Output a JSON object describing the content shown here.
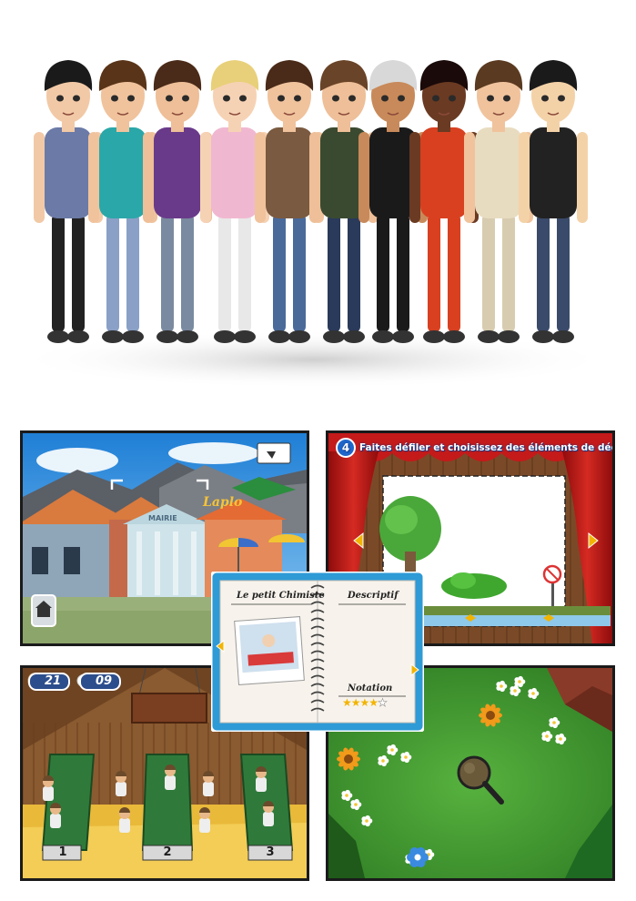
{
  "village": {
    "sign_text": "Laplo",
    "town_hall_label": "MAIRIE"
  },
  "stage": {
    "step_number": "4",
    "instruction": "Faites défiler et choisissez des éléments de décor"
  },
  "notebook": {
    "title": "Le petit Chimiste",
    "description_label": "Descriptif",
    "rating_label": "Notation",
    "rating": 4,
    "rating_max": 5
  },
  "barn": {
    "eggs_count": "21",
    "fried_eggs_count": "09",
    "table_numbers": [
      "1",
      "2",
      "3"
    ]
  },
  "garden": {
    "tool": "magnifying-glass"
  },
  "colors": {
    "accent_blue": "#1f66c9",
    "curtain_red": "#c41a1a",
    "grass_green": "#3a9a2c"
  }
}
